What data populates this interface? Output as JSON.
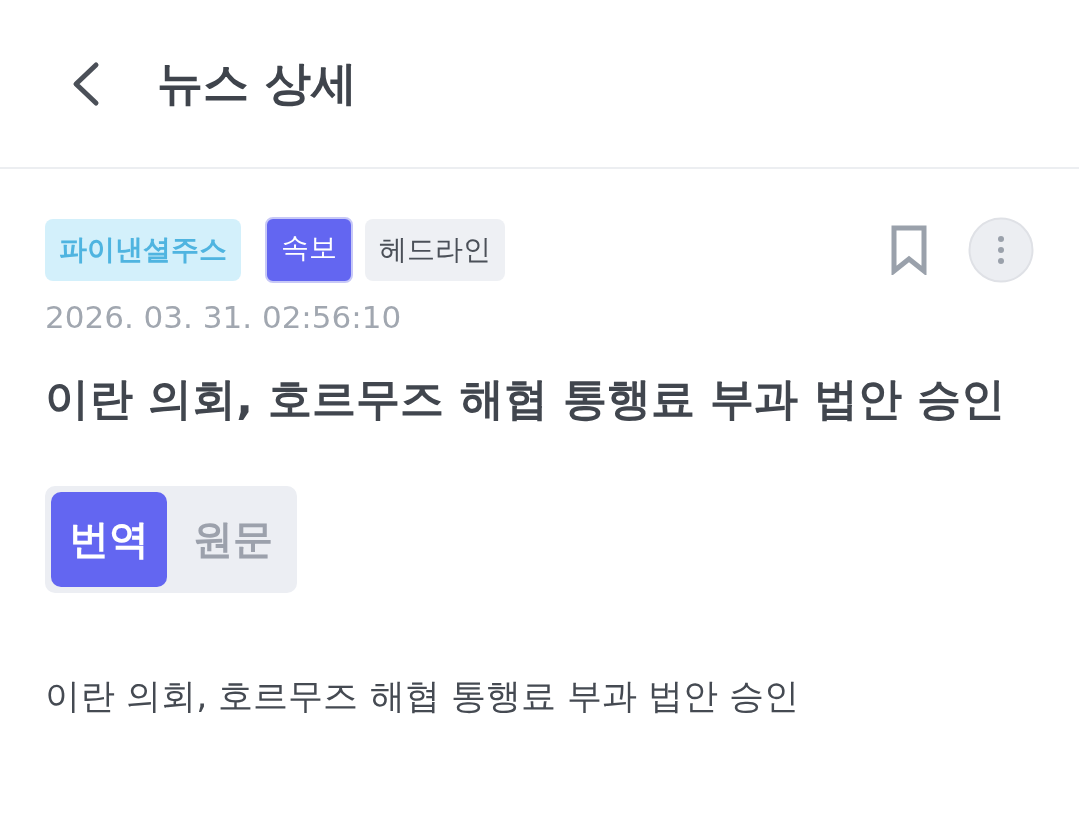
{
  "header": {
    "title": "뉴스 상세"
  },
  "tags": [
    {
      "label": "파이낸셜주스",
      "kind": "source"
    },
    {
      "label": "속보",
      "kind": "breaking"
    },
    {
      "label": "헤드라인",
      "kind": "category"
    }
  ],
  "date": "2026. 03. 31. 02:56:10",
  "headline": "이란 의회, 호르무즈 해협 통행료 부과 법안 승인",
  "language_tabs": [
    {
      "label": "번역",
      "selected": true
    },
    {
      "label": "원문",
      "selected": false
    }
  ],
  "body": "이란 의회, 호르무즈 해협 통행료 부과 법안 승인"
}
